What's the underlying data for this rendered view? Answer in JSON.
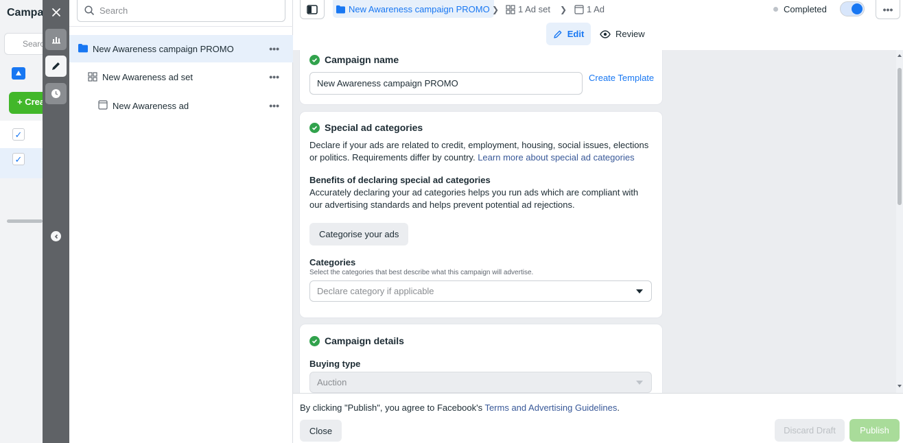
{
  "background": {
    "title": "Campaigns",
    "search_placeholder": "Search",
    "create_label": "+ Create"
  },
  "rail": {
    "icons": [
      "close-icon",
      "chart-icon",
      "pencil-icon",
      "clock-icon",
      "chevron-left-icon"
    ]
  },
  "tree": {
    "search_placeholder": "Search",
    "items": [
      {
        "label": "New Awareness campaign PROMO",
        "icon": "folder-icon",
        "more": "•••"
      },
      {
        "label": "New Awareness ad set",
        "icon": "grid-icon",
        "more": "•••"
      },
      {
        "label": "New Awareness ad",
        "icon": "ad-icon",
        "more": "•••"
      }
    ]
  },
  "topbar": {
    "breadcrumb_campaign": "New Awareness campaign PROMO",
    "breadcrumb_adset": "1 Ad set",
    "breadcrumb_ad": "1 Ad",
    "status": "Completed",
    "toggle_on": true,
    "more": "•••",
    "edit_label": "Edit",
    "review_label": "Review"
  },
  "campaign_name": {
    "title": "Campaign name",
    "value": "New Awareness campaign PROMO",
    "create_template": "Create Template"
  },
  "special_categories": {
    "title": "Special ad categories",
    "description": "Declare if your ads are related to credit, employment, housing, social issues, elections or politics. Requirements differ by country.",
    "learn_more": "Learn more about special ad categories",
    "benefits_title": "Benefits of declaring special ad categories",
    "benefits_text": "Accurately declaring your ad categories helps you run ads which are compliant with our advertising standards and helps prevent potential ad rejections.",
    "categorise_button": "Categorise your ads",
    "categories_label": "Categories",
    "categories_hint": "Select the categories that best describe what this campaign will advertise.",
    "categories_placeholder": "Declare category if applicable"
  },
  "campaign_details": {
    "title": "Campaign details",
    "buying_type_label": "Buying type",
    "buying_type_value": "Auction"
  },
  "footer": {
    "agreement_prefix": "By clicking \"Publish\", you agree to Facebook's ",
    "agreement_link": "Terms and Advertising Guidelines",
    "agreement_suffix": ".",
    "close": "Close",
    "discard": "Discard Draft",
    "publish": "Publish"
  },
  "colors": {
    "accent": "#1877f2",
    "success": "#31a24c",
    "publish_disabled": "#a9dc9a"
  }
}
